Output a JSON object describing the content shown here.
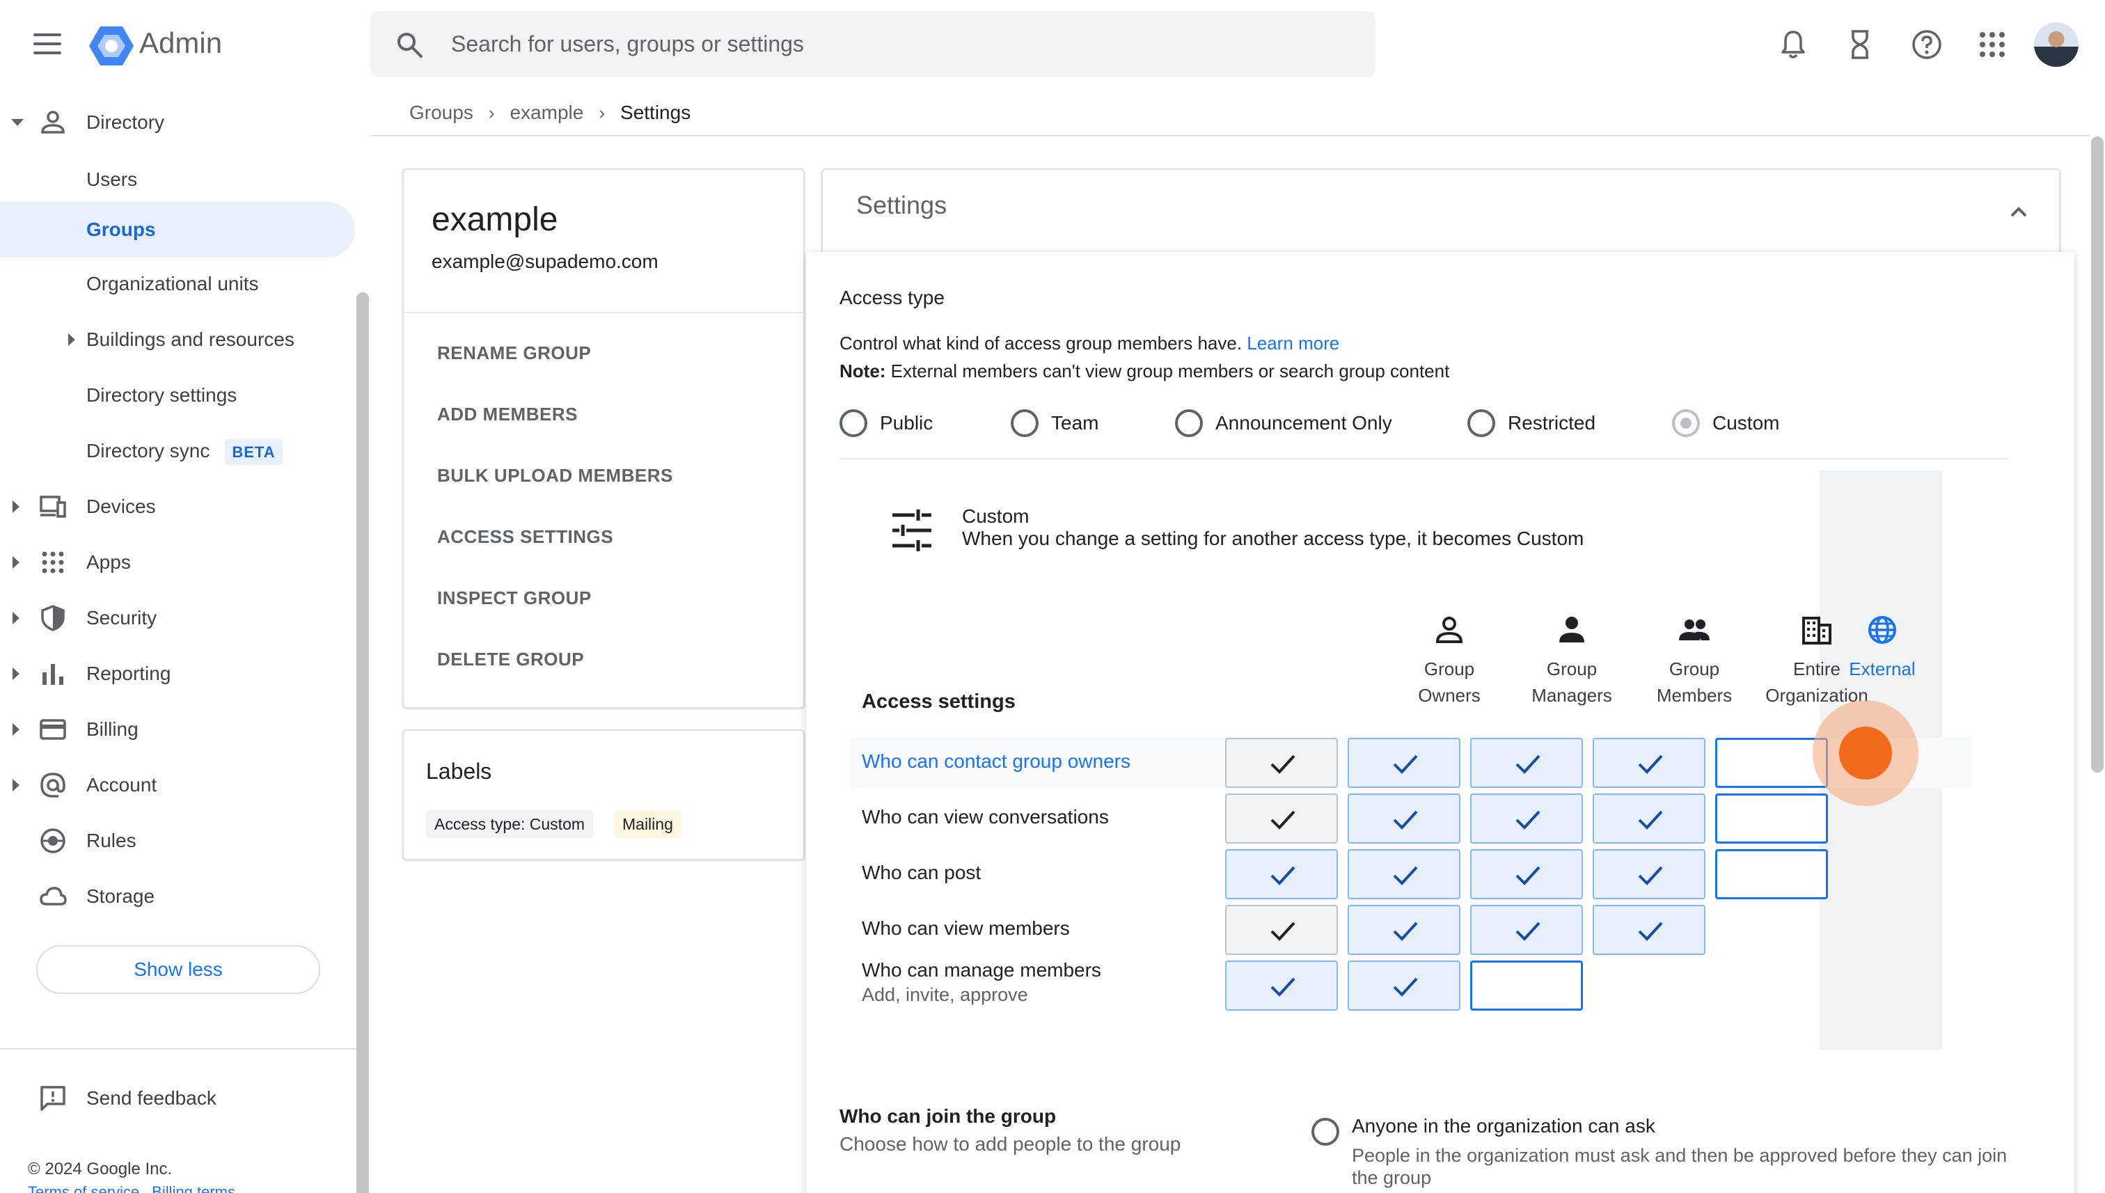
{
  "app": {
    "title": "Admin"
  },
  "search": {
    "placeholder": "Search for users, groups or settings"
  },
  "sidebar": {
    "directory": "Directory",
    "users": "Users",
    "groups": "Groups",
    "org_units": "Organizational units",
    "buildings": "Buildings and resources",
    "directory_settings": "Directory settings",
    "directory_sync": "Directory sync",
    "beta": "BETA",
    "devices": "Devices",
    "apps": "Apps",
    "security": "Security",
    "reporting": "Reporting",
    "billing": "Billing",
    "account": "Account",
    "rules": "Rules",
    "storage": "Storage",
    "show_less": "Show less",
    "send_feedback": "Send feedback",
    "copyright": "© 2024 Google Inc.",
    "terms": "Terms of service",
    "billing_terms": "Billing terms"
  },
  "breadcrumb": {
    "groups": "Groups",
    "example": "example",
    "current": "Settings"
  },
  "group": {
    "name": "example",
    "email": "example@supademo.com",
    "actions": [
      "RENAME GROUP",
      "ADD MEMBERS",
      "BULK UPLOAD MEMBERS",
      "ACCESS SETTINGS",
      "INSPECT GROUP",
      "DELETE GROUP"
    ]
  },
  "labels": {
    "title": "Labels",
    "chips": [
      "Access type: Custom",
      "Mailing"
    ]
  },
  "settings": {
    "title": "Settings",
    "access_type": "Access type",
    "description": "Control what kind of access group members have. ",
    "learn_more": "Learn more",
    "note_label": "Note:",
    "note_text": " External members can't view group members or search group content",
    "access_options": [
      "Public",
      "Team",
      "Announcement Only",
      "Restricted",
      "Custom"
    ],
    "selected_option": "Custom",
    "custom_title": "Custom",
    "custom_desc": "When you change a setting for another access type, it becomes Custom",
    "access_settings_label": "Access settings",
    "columns": [
      {
        "line1": "Group",
        "line2": "Owners",
        "icon": "person-outline-icon"
      },
      {
        "line1": "Group",
        "line2": "Managers",
        "icon": "person-icon"
      },
      {
        "line1": "Group",
        "line2": "Members",
        "icon": "people-icon"
      },
      {
        "line1": "Entire",
        "line2": "Organization",
        "icon": "building-icon"
      },
      {
        "line1": "External",
        "line2": "",
        "icon": "globe-icon"
      }
    ],
    "rows": [
      {
        "label": "Who can contact group owners",
        "sub": "",
        "cells": [
          "gray-check",
          "blue-check",
          "blue-check",
          "blue-check",
          "empty"
        ]
      },
      {
        "label": "Who can view conversations",
        "sub": "",
        "cells": [
          "gray-check",
          "blue-check",
          "blue-check",
          "blue-check",
          "empty"
        ]
      },
      {
        "label": "Who can post",
        "sub": "",
        "cells": [
          "blue-check",
          "blue-check",
          "blue-check",
          "blue-check",
          "empty"
        ]
      },
      {
        "label": "Who can view members",
        "sub": "",
        "cells": [
          "gray-check",
          "blue-check",
          "blue-check",
          "blue-check",
          "none"
        ]
      },
      {
        "label": "Who can manage members",
        "sub": "Add, invite, approve",
        "cells": [
          "blue-check",
          "blue-check",
          "empty",
          "none",
          "none"
        ]
      }
    ],
    "join_title": "Who can join the group",
    "join_sub": "Choose how to add people to the group",
    "join_option": "Anyone in the organization can ask",
    "join_option_desc": "People in the organization must ask and then be approved before they can join the group"
  },
  "colors": {
    "accent": "#1a73e8",
    "active_bg": "#e8f0fe",
    "cursor": "#f26b1d"
  }
}
